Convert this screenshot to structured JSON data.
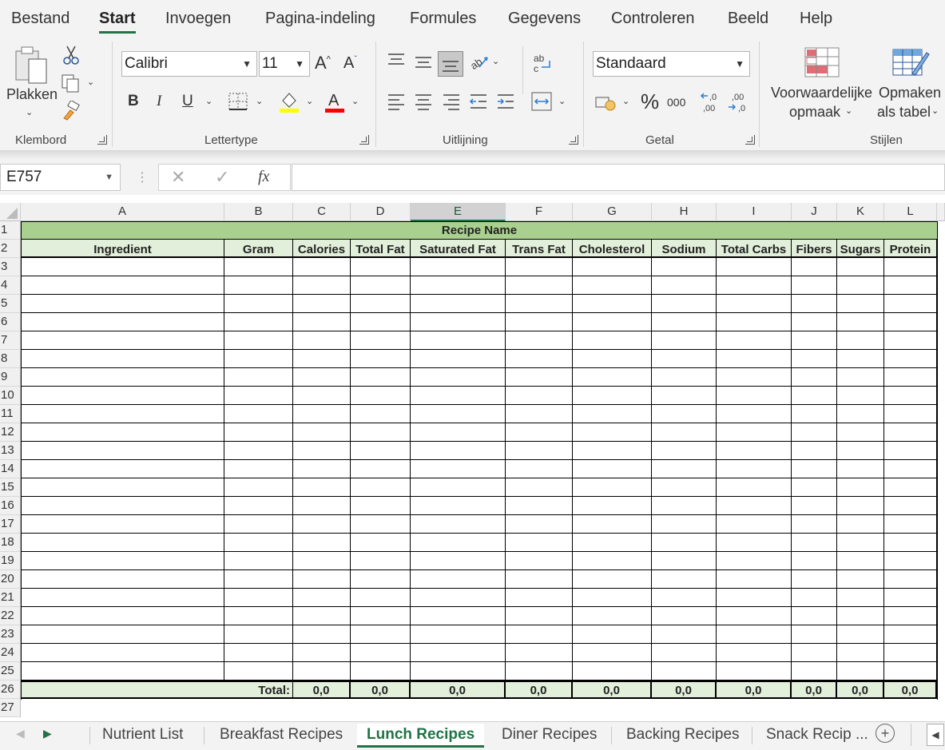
{
  "menu": {
    "tabs": [
      "Bestand",
      "Start",
      "Invoegen",
      "Pagina-indeling",
      "Formules",
      "Gegevens",
      "Controleren",
      "Beeld",
      "Help"
    ],
    "active_index": 1
  },
  "ribbon": {
    "clipboard": {
      "paste_label": "Plakken",
      "group_label": "Klembord"
    },
    "font": {
      "font_name": "Calibri",
      "font_size": "11",
      "grow": "A",
      "shrink": "A",
      "bold": "B",
      "italic": "I",
      "underline": "U",
      "group_label": "Lettertype",
      "highlight_color": "#ffff00",
      "font_color": "#ff0000"
    },
    "alignment": {
      "group_label": "Uitlijning",
      "wrap": "ab"
    },
    "number": {
      "format": "Standaard",
      "percent": "%",
      "thousands": "000",
      "dec_increase": ",00",
      "dec_decrease": ",00",
      "group_label": "Getal"
    },
    "styles": {
      "conditional_1": "Voorwaardelijke",
      "conditional_2": "opmaak",
      "table_1": "Opmaken",
      "table_2": "als tabel",
      "group_label": "Stijlen"
    }
  },
  "formula_bar": {
    "name_box": "E757",
    "fx": "fx",
    "value": ""
  },
  "sheet": {
    "columns": [
      "A",
      "B",
      "C",
      "D",
      "E",
      "F",
      "G",
      "H",
      "I",
      "J",
      "K",
      "L"
    ],
    "selected_column": "E",
    "rows": [
      "1",
      "2",
      "3",
      "4",
      "5",
      "6",
      "7",
      "8",
      "9",
      "10",
      "11",
      "12",
      "13",
      "14",
      "15",
      "16",
      "17",
      "18",
      "19",
      "20",
      "21",
      "22",
      "23",
      "24",
      "25",
      "26",
      "27"
    ],
    "title": "Recipe Name",
    "headers": [
      "Ingredient",
      "Gram",
      "Calories",
      "Total Fat",
      "Saturated Fat",
      "Trans Fat",
      "Cholesterol",
      "Sodium",
      "Total Carbs",
      "Fibers",
      "Sugars",
      "Protein"
    ],
    "total_label": "Total:",
    "totals": [
      "0,0",
      "0,0",
      "0,0",
      "0,0",
      "0,0",
      "0,0",
      "0,0",
      "0,0",
      "0,0",
      "0,0"
    ],
    "colors": {
      "title_bg": "#a9d08e",
      "header_bg": "#e2efda",
      "accent": "#217346"
    }
  },
  "sheet_tabs": {
    "tabs": [
      "Nutrient List",
      "Breakfast Recipes",
      "Lunch Recipes",
      "Diner Recipes",
      "Backing Recipes",
      "Snack Recip ..."
    ],
    "active_index": 2
  }
}
